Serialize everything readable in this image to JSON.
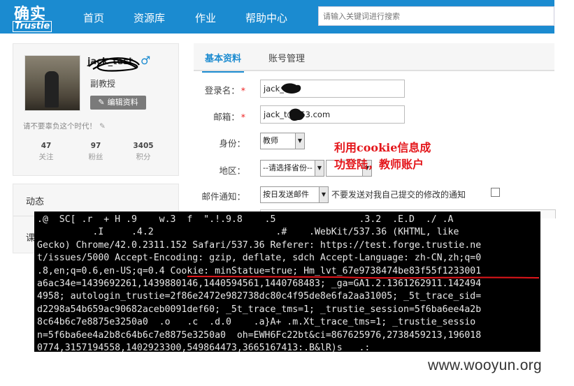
{
  "header": {
    "logo_cn": "确实",
    "logo_en": "Trustie",
    "nav": [
      "首页",
      "资源库",
      "作业",
      "帮助中心"
    ],
    "search_placeholder": "请输入关键词进行搜索"
  },
  "profile": {
    "username": "jack_test",
    "gender_symbol": "♂",
    "role": "副教授",
    "edit_label": "编辑资料",
    "motto": "请不要辜负这个时代！",
    "stats": [
      {
        "num": "47",
        "label": "关注"
      },
      {
        "num": "97",
        "label": "粉丝"
      },
      {
        "num": "3405",
        "label": "积分"
      }
    ]
  },
  "sidebar2": {
    "item1": "动态",
    "item2": "课"
  },
  "tabs": {
    "basic": "基本资料",
    "account": "账号管理"
  },
  "form": {
    "login_label": "登录名：",
    "login_value": "jack_test",
    "email_label": "邮箱：",
    "email_value": "jack_t@163.com",
    "identity_label": "身份：",
    "identity_value": "教师",
    "region_label": "地区：",
    "region_value": "--请选择省份--",
    "notify_label": "邮件通知：",
    "notify_value": "按日发送邮件",
    "notify_checkbox_label": "不要发送对我自己提交的修改的通知",
    "required_mark": "*"
  },
  "annotation": {
    "line1": "利用cookie信息成",
    "line2": "功登陆，教师账户"
  },
  "terminal": {
    "lines": [
      ".@  SC[ .r  + H .9    w.3  f  \".!.9.8    .5               .3.2  .E.D  ./ .A",
      "          .I     .4.2                      .#    .WebKit/537.36 (KHTML, like",
      "Gecko) Chrome/42.0.2311.152 Safari/537.36 Referer: https://test.forge.trustie.ne",
      "t/issues/5000 Accept-Encoding: gzip, deflate, sdch Accept-Language: zh-CN,zh;q=0",
      ".8,en;q=0.6,en-US;q=0.4 Cookie: minStatue=true; Hm_lvt_67e9738474be83f55f1233001",
      "a6ac34e=1439692261,1439880146,1440594561,1440768483; _ga=GA1.2.1361262911.142494",
      "4958; autologin_trustie=2f86e2472e982738dc80c4f95de8e6fa2aa31005; _5t_trace_sid=",
      "d2298a54b659ac90682aceb0091def60; _5t_trace_tms=1; _trustie_session=5f6ba6ee4a2b",
      "8c64b6c7e8875e3250a0  .o   .c  .d.0    .a}A+ .m.Xt_trace_tms=1; _trustie_sessio",
      "n=5f6ba6ee4a2b8c64b6c7e8875e3250a0  oh=EWH6Fc22bt&ci=867625976,2738459213,196018",
      "0774,3157194558,1402923300,549864473,3665167413:.B&lR)s   .:"
    ]
  },
  "watermark": "www.wooyun.org",
  "colors": {
    "brand": "#1b8bd0",
    "annotation": "#e4161b",
    "terminal_bg": "#000000",
    "underline": "#e4161b"
  }
}
